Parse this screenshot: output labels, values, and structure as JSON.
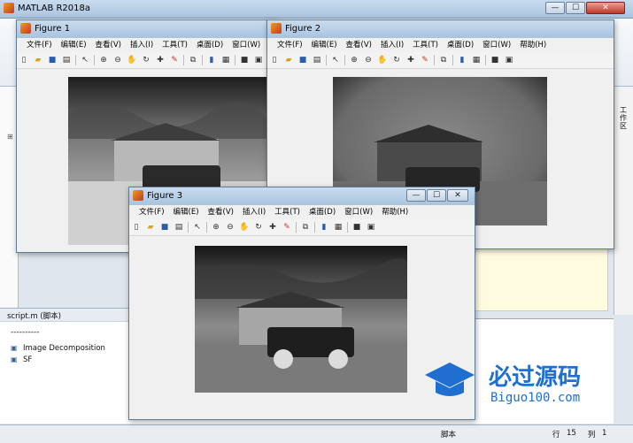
{
  "app": {
    "title": "MATLAB R2018a",
    "left_panel": {
      "script_title": "script.m  (脚本)",
      "dashes": "----------",
      "items": [
        "Image Decomposition",
        "SF"
      ]
    },
    "right_tab": "工作区",
    "status": {
      "mode": "脚本",
      "row_label": "行",
      "row": "15",
      "col_label": "列",
      "col": "1"
    }
  },
  "menus": [
    "文件(F)",
    "编辑(E)",
    "查看(V)",
    "插入(I)",
    "工具(T)",
    "桌面(D)",
    "窗口(W)",
    "帮助(H)"
  ],
  "figures": [
    {
      "title": "Figure 1"
    },
    {
      "title": "Figure 2"
    },
    {
      "title": "Figure 3"
    }
  ],
  "toolbar_icons": [
    "new-icon",
    "open-icon",
    "save-icon",
    "print-icon",
    "pointer-icon",
    "zoom-in-icon",
    "zoom-out-icon",
    "pan-icon",
    "rotate-icon",
    "data-cursor-icon",
    "brush-icon",
    "link-icon",
    "insert-colorbar-icon",
    "insert-legend-icon",
    "hide-plot-tools-icon",
    "show-plot-tools-icon"
  ],
  "watermark": {
    "title": "必过源码",
    "url": "Biguo100.com"
  },
  "colors": {
    "titlebar": "#b9d0e8",
    "close": "#c0392b",
    "accent": "#1e6fd0"
  }
}
